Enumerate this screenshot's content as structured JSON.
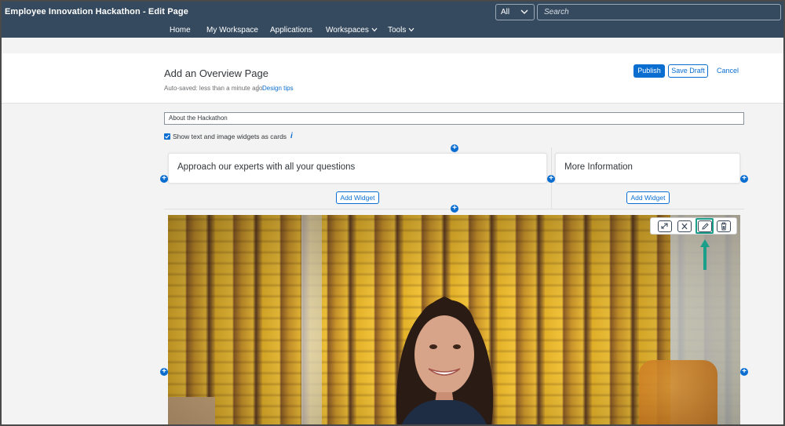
{
  "shell": {
    "app_title": "Employee Innovation Hackathon - Edit Page",
    "search_scope": "All",
    "search_placeholder": "Search",
    "nav": [
      "Home",
      "My Workspace",
      "Applications",
      "Workspaces",
      "Tools"
    ]
  },
  "page_header": {
    "title": "Add an Overview Page",
    "autosave": "Auto-saved: less than a minute ago",
    "separator": "|",
    "design_tips": "Design tips",
    "publish": "Publish",
    "save_draft": "Save Draft",
    "cancel": "Cancel"
  },
  "editor": {
    "page_title_value": "About the Hackathon",
    "cards_checkbox_label": "Show text and image widgets as cards",
    "cards_checkbox_checked": true,
    "info_glyph": "i",
    "plus_glyph": "+",
    "cards": [
      {
        "title": "Approach our experts with all your questions",
        "add_widget": "Add Widget"
      },
      {
        "title": "More Information",
        "add_widget": "Add Widget"
      }
    ],
    "image_toolbar": [
      "expand-icon",
      "close-icon",
      "edit-pencil-icon",
      "delete-trash-icon"
    ]
  },
  "colors": {
    "shell_bg": "#354a5f",
    "accent": "#0a6ed1",
    "highlight": "#1aa08a"
  }
}
